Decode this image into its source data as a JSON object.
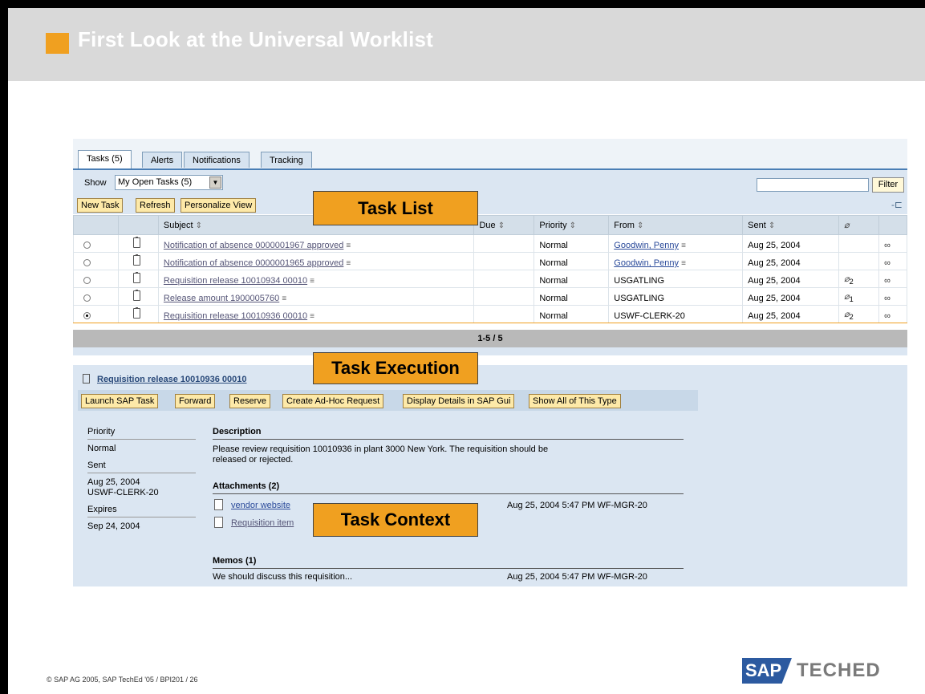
{
  "slide": {
    "title": "First Look at the Universal Worklist",
    "copyright": "© SAP AG 2005, SAP TechEd '05 / BPI201 / 26",
    "logo_left": "SAP",
    "logo_right": "TECHED"
  },
  "colors": {
    "accent": "#f0a020",
    "panel": "#dbe6f2",
    "link": "#2a4a9a"
  },
  "tabs": [
    {
      "label": "Tasks (5)"
    },
    {
      "label": "Alerts"
    },
    {
      "label": "Notifications"
    },
    {
      "label": "Tracking"
    }
  ],
  "filter_bar": {
    "show_label": "Show",
    "show_value": "My Open Tasks  (5)",
    "filter_button": "Filter",
    "filter_value": ""
  },
  "toolbar": {
    "new_task": "New Task",
    "refresh": "Refresh",
    "personalize": "Personalize View"
  },
  "table": {
    "headers": {
      "subject": "Subject",
      "due": "Due",
      "priority": "Priority",
      "from": "From",
      "sent": "Sent"
    },
    "rows": [
      {
        "subject": "Notification of absence 0000001967 approved",
        "priority": "Normal",
        "from": "Goodwin, Penny",
        "sent": "Aug 25, 2004",
        "attachments": "",
        "selected": false
      },
      {
        "subject": "Notification of absence 0000001965 approved",
        "priority": "Normal",
        "from": "Goodwin, Penny",
        "sent": "Aug 25, 2004",
        "attachments": "",
        "selected": false
      },
      {
        "subject": "Requisition release 10010934 00010",
        "priority": "Normal",
        "from": "USGATLING",
        "sent": "Aug 25, 2004",
        "attachments": "2",
        "selected": false
      },
      {
        "subject": "Release amount 1900005760",
        "priority": "Normal",
        "from": "USGATLING",
        "sent": "Aug 25, 2004",
        "attachments": "1",
        "selected": false
      },
      {
        "subject": "Requisition release 10010936 00010",
        "priority": "Normal",
        "from": "USWF-CLERK-20",
        "sent": "Aug 25, 2004",
        "attachments": "2",
        "selected": true
      }
    ],
    "pager": "1-5  / 5"
  },
  "callouts": {
    "task_list": "Task List",
    "task_execution": "Task Execution",
    "task_context": "Task Context"
  },
  "execution": {
    "title": "Requisition release 10010936 00010",
    "buttons": [
      "Launch SAP Task",
      "Forward",
      "Reserve",
      "Create Ad-Hoc Request",
      "Display Details in SAP Gui",
      "Show All of This Type"
    ],
    "sidebar": {
      "priority_label": "Priority",
      "priority_value": "Normal",
      "sent_label": "Sent",
      "sent_value_date": "Aug 25, 2004",
      "sent_value_user": "USWF-CLERK-20",
      "expires_label": "Expires",
      "expires_value": "Sep 24, 2004"
    },
    "description_title": "Description",
    "description_text": "Please review requisition 10010936 in plant 3000 New York.  The requisition should be released or rejected.",
    "attachments_title": "Attachments (2)",
    "attachments": [
      {
        "name": "vendor website",
        "meta": "Aug 25, 2004 5:47 PM WF-MGR-20"
      },
      {
        "name": "Requisition item",
        "meta": ""
      }
    ],
    "memos_title": "Memos (1)",
    "memo_text": "We should discuss this requisition...",
    "memo_meta": "Aug 25, 2004 5:47 PM WF-MGR-20"
  }
}
